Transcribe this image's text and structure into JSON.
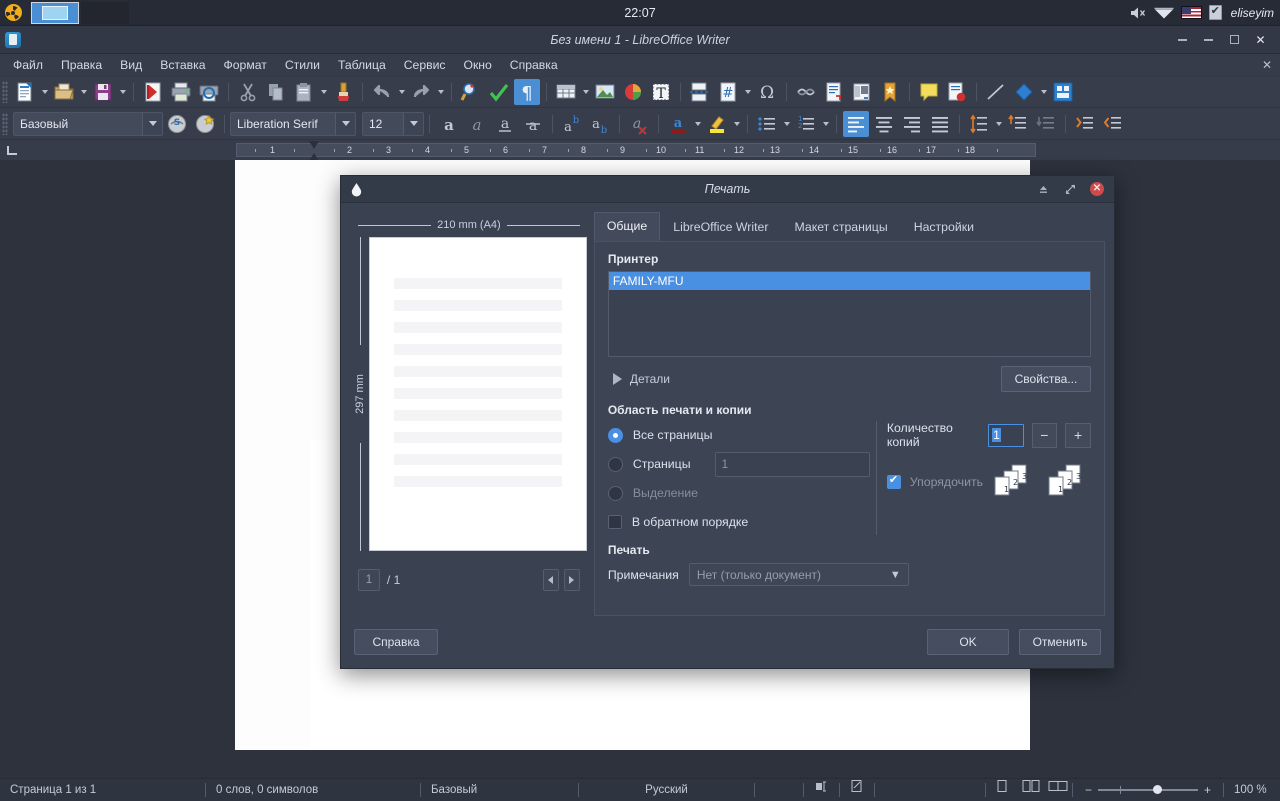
{
  "panel": {
    "clock": "22:07",
    "logo_icon": "radioactive-logo-icon",
    "tasks": [
      {
        "name": "libreoffice-writer-window",
        "active": true
      },
      {
        "name": "second-window",
        "active": false
      }
    ],
    "tray": {
      "volume_icon": "volume-muted-icon",
      "network_icon": "wifi-icon",
      "keyboard_layout_icon": "us-flag-icon",
      "checkbox_icon": "clipboard-check-icon",
      "user": "eliseyim"
    }
  },
  "window": {
    "title": "Без имени 1 - LibreOffice Writer",
    "app_icon": "libreoffice-writer-icon",
    "buttons": {
      "shade": "shade-icon",
      "minimize": "minimize-icon",
      "maximize": "maximize-icon",
      "close": "close-icon"
    }
  },
  "menubar": {
    "items": [
      "Файл",
      "Правка",
      "Вид",
      "Вставка",
      "Формат",
      "Стили",
      "Таблица",
      "Сервис",
      "Окно",
      "Справка"
    ],
    "close_doc_icon": "close-document-icon"
  },
  "toolbar_main": [
    "new-document-icon",
    "open-icon",
    "save-icon",
    "export-pdf-icon",
    "print-icon",
    "print-preview-icon",
    "cut-icon",
    "copy-icon",
    "paste-icon",
    "clone-formatting-icon",
    "undo-icon",
    "redo-icon",
    "find-replace-icon",
    "spelling-icon",
    "formatting-marks-icon",
    "insert-table-icon",
    "insert-image-icon",
    "insert-chart-icon",
    "insert-textbox-icon",
    "page-break-icon",
    "insert-field-icon",
    "special-character-icon",
    "insert-hyperlink-icon",
    "footnote-icon",
    "endnote-icon",
    "bookmark-icon",
    "comment-icon",
    "track-changes-icon",
    "line-icon",
    "basic-shapes-icon",
    "show-draw-functions-icon"
  ],
  "toolbar_format": {
    "paragraph_style": "Базовый",
    "font_name": "Liberation Serif",
    "font_size": "12",
    "buttons": [
      "update-style-icon",
      "new-style-icon",
      "bold-icon",
      "italic-icon",
      "underline-icon",
      "strikethrough-icon",
      "superscript-icon",
      "subscript-icon",
      "clear-formatting-icon",
      "font-color-icon",
      "highlight-color-icon",
      "unordered-list-icon",
      "ordered-list-icon",
      "align-left-icon",
      "align-center-icon",
      "align-right-icon",
      "justified-icon",
      "line-spacing-icon",
      "increase-paragraph-spacing-icon",
      "decrease-paragraph-spacing-icon",
      "increase-indent-icon",
      "decrease-indent-icon"
    ]
  },
  "ruler": {
    "ticks": [
      "1",
      "2",
      "3",
      "4",
      "5",
      "6",
      "7",
      "8",
      "9",
      "10",
      "11",
      "12",
      "13",
      "14",
      "15",
      "16",
      "17",
      "18"
    ]
  },
  "dialog": {
    "title": "Печать",
    "app_icon": "libreoffice-drop-icon",
    "close_icon": "close-icon",
    "shade_icon": "shade-icon",
    "maximize_icon": "maximize-icon",
    "tabs": [
      {
        "label": "Общие",
        "active": true
      },
      {
        "label": "LibreOffice Writer",
        "active": false
      },
      {
        "label": "Макет страницы",
        "active": false
      },
      {
        "label": "Настройки",
        "active": false
      }
    ],
    "preview": {
      "width_label": "210 mm (A4)",
      "height_label": "297 mm",
      "page_current": "1",
      "page_total": "/ 1",
      "prev_icon": "previous-page-icon",
      "next_icon": "next-page-icon"
    },
    "printer": {
      "group_label": "Принтер",
      "selected": "FAMILY-MFU",
      "details_label": "Детали",
      "details_icon": "triangle-right-icon",
      "properties_label": "Свойства..."
    },
    "range": {
      "group_label": "Область печати и копии",
      "all_pages_label": "Все страницы",
      "all_pages_checked": true,
      "pages_label": "Страницы",
      "pages_checked": false,
      "pages_value": "1",
      "selection_label": "Выделение",
      "selection_checked": false,
      "selection_disabled": true,
      "reverse_label": "В обратном порядке",
      "reverse_checked": false
    },
    "copies": {
      "label": "Количество копий",
      "value": "1",
      "minus_label": "−",
      "plus_label": "+",
      "collate_label": "Упорядочить",
      "collate_checked": true,
      "collate_icon": "collate-pages-icon"
    },
    "print_section": {
      "group_label": "Печать",
      "comments_label": "Примечания",
      "comments_value": "Нет (только документ)",
      "dropdown_icon": "chevron-down-icon"
    },
    "footer": {
      "help_label": "Справка",
      "ok_label": "OK",
      "cancel_label": "Отменить"
    }
  },
  "statusbar": {
    "page": "Страница 1 из 1",
    "words": "0 слов, 0 символов",
    "style": "Базовый",
    "language": "Русский",
    "selection_mode_icon": "selection-mode-icon",
    "save_state_icon": "document-modified-icon",
    "view_single_icon": "single-page-view-icon",
    "view_multi_icon": "multi-page-view-icon",
    "view_book_icon": "book-view-icon",
    "zoom_minus": "−",
    "zoom_plus": "+",
    "zoom": "100 %"
  }
}
